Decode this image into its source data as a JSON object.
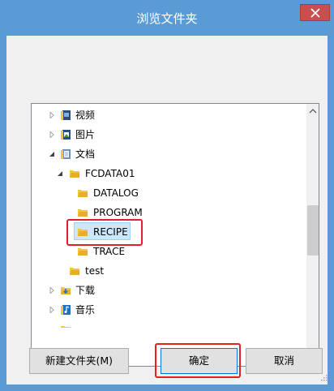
{
  "window": {
    "title": "浏览文件夹"
  },
  "tree": {
    "items": [
      {
        "label": "视频",
        "icon": "video-library-icon",
        "expander": "collapsed"
      },
      {
        "label": "图片",
        "icon": "pictures-library-icon",
        "expander": "collapsed"
      },
      {
        "label": "文档",
        "icon": "documents-library-icon",
        "expander": "expanded"
      },
      {
        "label": "FCDATA01",
        "icon": "folder-icon",
        "expander": "expanded"
      },
      {
        "label": "DATALOG",
        "icon": "folder-icon",
        "expander": "none"
      },
      {
        "label": "PROGRAM",
        "icon": "folder-icon",
        "expander": "none"
      },
      {
        "label": "RECIPE",
        "icon": "folder-icon",
        "expander": "none",
        "selected": true
      },
      {
        "label": "TRACE",
        "icon": "folder-icon",
        "expander": "none"
      },
      {
        "label": "test",
        "icon": "folder-icon",
        "expander": "none"
      },
      {
        "label": "下载",
        "icon": "downloads-folder-icon",
        "expander": "collapsed"
      },
      {
        "label": "音乐",
        "icon": "music-library-icon",
        "expander": "collapsed"
      }
    ]
  },
  "buttons": {
    "new_folder": "新建文件夹(M)",
    "ok": "确定",
    "cancel": "取消"
  },
  "colors": {
    "titlebar": "#5b9bd5",
    "close_button": "#c94f4f",
    "selection_fill": "#cce8ff",
    "highlight_frame": "#e0202a",
    "folder_yellow": "#f5c443"
  }
}
